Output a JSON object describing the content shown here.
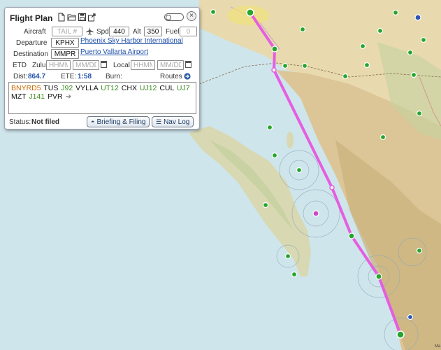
{
  "panel": {
    "title": "Flight Plan",
    "toolbar_icons": [
      "new-file-icon",
      "open-folder-icon",
      "save-icon",
      "share-icon"
    ],
    "close_glyph": "×"
  },
  "aircraft": {
    "label": "Aircraft",
    "placeholder": "TAIL #",
    "value": ""
  },
  "speed": {
    "label": "Spd",
    "value": "440"
  },
  "altitude": {
    "label": "Alt",
    "value": "350"
  },
  "fuel": {
    "label": "Fuel",
    "value": "0"
  },
  "departure": {
    "label": "Departure",
    "code": "KPHX",
    "name": "Phoenix Sky Harbor International"
  },
  "destination": {
    "label": "Destination",
    "code": "MMPR",
    "name": "Puerto Vallarta Airport"
  },
  "etd": {
    "label": "ETD",
    "zulu_label": "Zulu",
    "zulu_time_placeholder": "HHMM",
    "zulu_date_placeholder": "MM/DD",
    "local_label": "Local",
    "local_time_placeholder": "HHMM",
    "local_date_placeholder": "MM/DD"
  },
  "summary": {
    "dist_label": "Dist:",
    "dist_value": "864.7",
    "ete_label": "ETE:",
    "ete_value": "1:58",
    "burn_label": "Burn:",
    "routes_label": "Routes"
  },
  "route": {
    "tokens": [
      {
        "text": "BNYRD5",
        "kind": "orange"
      },
      {
        "text": "TUS",
        "kind": "black"
      },
      {
        "text": "J92",
        "kind": "green"
      },
      {
        "text": "VYLLA",
        "kind": "black"
      },
      {
        "text": "UT12",
        "kind": "green"
      },
      {
        "text": "CHX",
        "kind": "black"
      },
      {
        "text": "UJ12",
        "kind": "green"
      },
      {
        "text": "CUL",
        "kind": "black"
      },
      {
        "text": "UJ7",
        "kind": "green"
      },
      {
        "text": "MZT",
        "kind": "black"
      },
      {
        "text": "J141",
        "kind": "green"
      },
      {
        "text": "PVR",
        "kind": "black"
      }
    ],
    "arrow": "➔"
  },
  "status": {
    "label": "Status:",
    "value": "Not filed"
  },
  "buttons": {
    "briefing": "Briefing & Filing",
    "navlog": "Nav Log"
  },
  "map": {
    "route_color": "#e55ee0",
    "airport_color": "#27a52c",
    "attribution": "Ma"
  }
}
